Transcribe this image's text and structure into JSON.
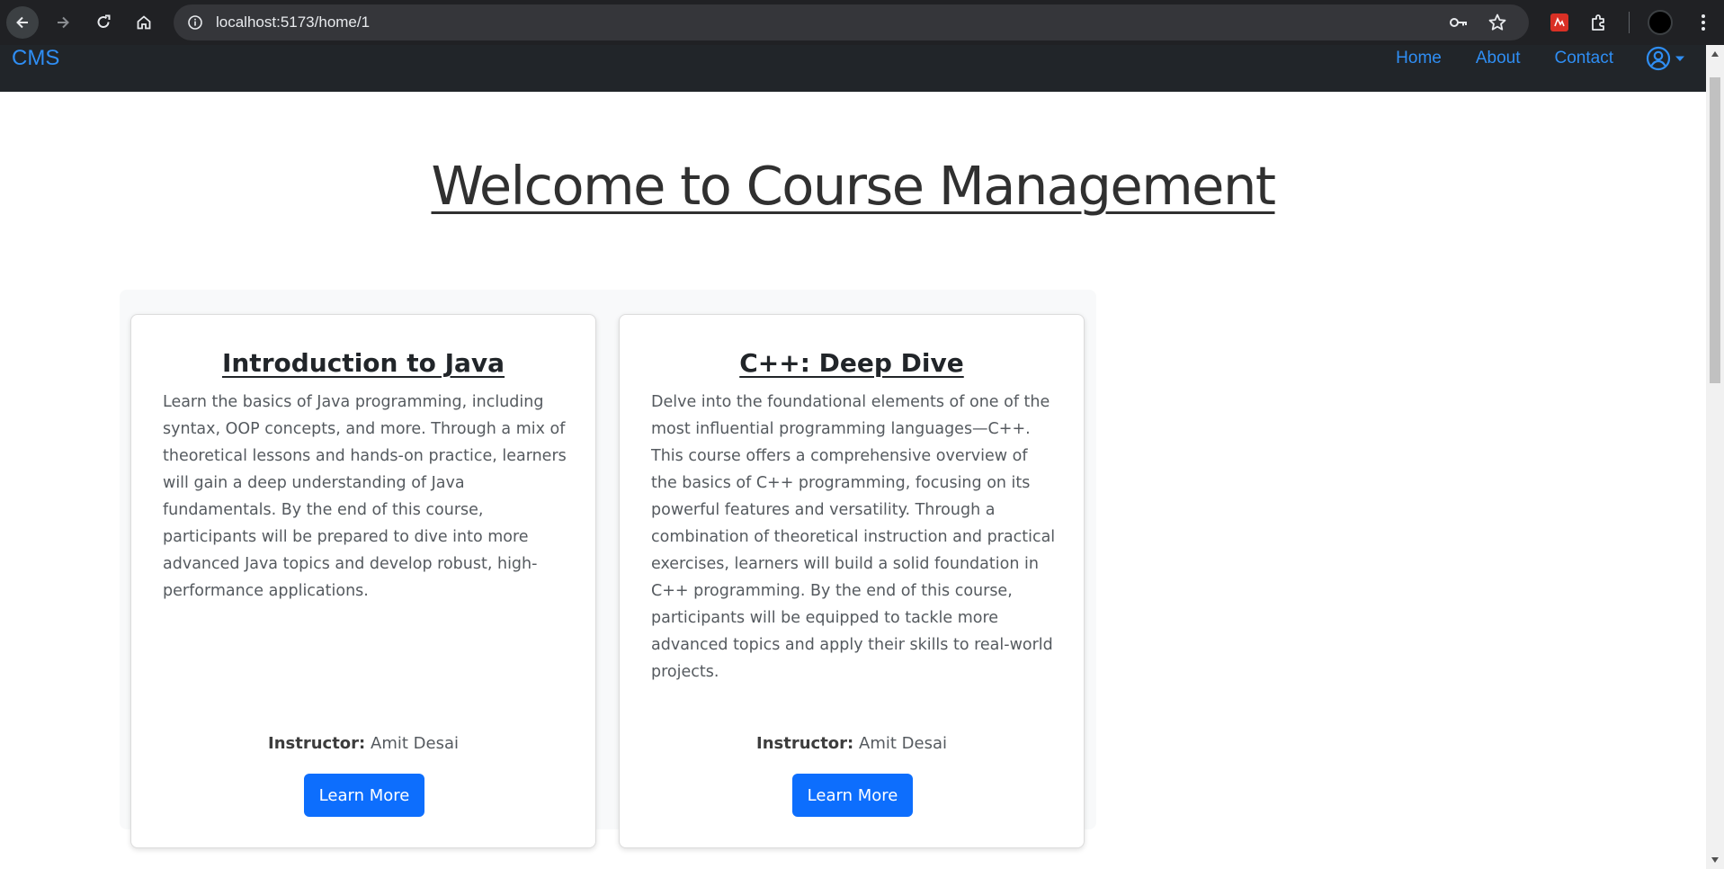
{
  "browser": {
    "url": "localhost:5173/home/1"
  },
  "navbar": {
    "brand": "CMS",
    "links": [
      "Home",
      "About",
      "Contact"
    ]
  },
  "main": {
    "title": "Welcome to Course Management",
    "courses": [
      {
        "title": "Introduction to Java",
        "description": "Learn the basics of Java programming, including syntax, OOP concepts, and more. Through a mix of theoretical lessons and hands-on practice, learners will gain a deep understanding of Java fundamentals. By the end of this course, participants will be prepared to dive into more advanced Java topics and develop robust, high-performance applications.",
        "instructor_label": "Instructor:",
        "instructor": "Amit Desai",
        "button_label": "Learn More"
      },
      {
        "title": "C++: Deep Dive",
        "description": "Delve into the foundational elements of one of the most influential programming languages—C++. This course offers a comprehensive overview of the basics of C++ programming, focusing on its powerful features and versatility. Through a combination of theoretical instruction and practical exercises, learners will build a solid foundation in C++ programming. By the end of this course, participants will be equipped to tackle more advanced topics and apply their skills to real-world projects.",
        "instructor_label": "Instructor:",
        "instructor": "Amit Desai",
        "button_label": "Learn More"
      }
    ]
  },
  "colors": {
    "navbar_bg": "#212529",
    "link": "#2f8ef4",
    "primary_button": "#0d6efd"
  }
}
